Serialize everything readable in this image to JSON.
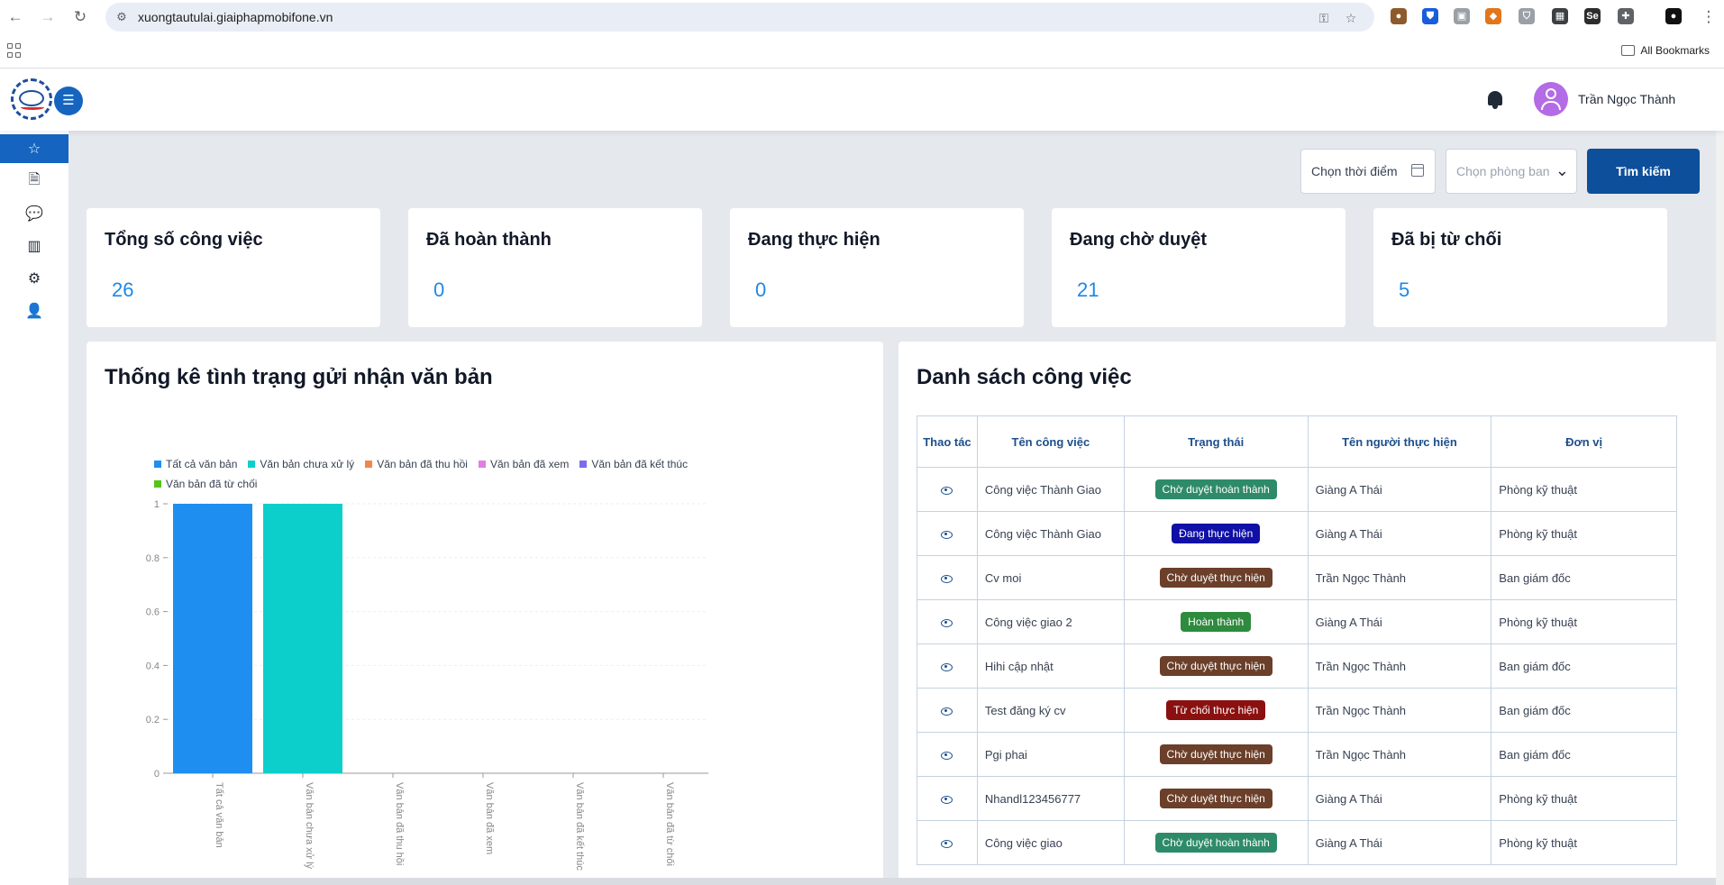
{
  "browser": {
    "url": "xuongtautulai.giaiphapmobifone.vn",
    "bookmarks_label": "All Bookmarks",
    "extensions": [
      {
        "name": "cookie-extension-icon",
        "color": "#8d5a2b",
        "glyph": "●"
      },
      {
        "name": "bitwarden-extension-icon",
        "color": "#175ddc",
        "glyph": "⛊"
      },
      {
        "name": "image-extension-icon",
        "color": "#9aa0a6",
        "glyph": "▣"
      },
      {
        "name": "metamask-extension-icon",
        "color": "#e2761b",
        "glyph": "◆"
      },
      {
        "name": "shield-extension-icon",
        "color": "#9aa0a6",
        "glyph": "⛉"
      },
      {
        "name": "qr-extension-icon",
        "color": "#3c4043",
        "glyph": "▦"
      },
      {
        "name": "selenium-extension-icon",
        "color": "#2d2d2d",
        "glyph": "Se"
      },
      {
        "name": "puzzle-extension-icon",
        "color": "#5f6368",
        "glyph": "✚"
      },
      {
        "name": "profile-extension-icon",
        "color": "#111111",
        "glyph": "●"
      }
    ]
  },
  "header": {
    "user_name": "Trần Ngọc Thành"
  },
  "sidebar": {
    "items": [
      {
        "name": "sidebar-item-favorites",
        "icon": "star-icon",
        "glyph": "☆",
        "active": true
      },
      {
        "name": "sidebar-item-documents",
        "icon": "document-icon",
        "glyph": "🗎",
        "active": false
      },
      {
        "name": "sidebar-item-messages",
        "icon": "chat-icon",
        "glyph": "💬",
        "active": false
      },
      {
        "name": "sidebar-item-board",
        "icon": "kanban-icon",
        "glyph": "▥",
        "active": false
      },
      {
        "name": "sidebar-item-settings",
        "icon": "gear-icon",
        "glyph": "⚙",
        "active": false
      },
      {
        "name": "sidebar-item-users",
        "icon": "user-icon",
        "glyph": "👤",
        "active": false
      }
    ]
  },
  "filters": {
    "time_label": "Chọn thời điểm",
    "dept_placeholder": "Chọn phòng ban",
    "search_label": "Tìm kiếm"
  },
  "stats": [
    {
      "title": "Tổng số công việc",
      "value": "26"
    },
    {
      "title": "Đã hoàn thành",
      "value": "0"
    },
    {
      "title": "Đang thực hiện",
      "value": "0"
    },
    {
      "title": "Đang chờ duyệt",
      "value": "21"
    },
    {
      "title": "Đã bị từ chối",
      "value": "5"
    }
  ],
  "chart_panel": {
    "title": "Thống kê tình trạng gửi nhận văn bản"
  },
  "chart_data": {
    "type": "bar",
    "categories": [
      "Tất cả văn bản",
      "Văn bản chưa xử lý",
      "Văn bản đã thu hồi",
      "Văn bản đã xem",
      "Văn bản đã kết thúc",
      "Văn bản đã từ chối"
    ],
    "values": [
      1,
      1,
      0,
      0,
      0,
      0
    ],
    "colors": [
      "#1f8ef1",
      "#0ccfcc",
      "#f2874d",
      "#e07ee6",
      "#7a6cf0",
      "#52c41a"
    ],
    "ylim": [
      0,
      1
    ],
    "yticks": [
      "0",
      "0.2",
      "0.4",
      "0.6",
      "0.8",
      "1"
    ],
    "legend_placement": "top-left",
    "grid": true
  },
  "task_panel": {
    "title": "Danh sách công việc",
    "columns": [
      "Thao tác",
      "Tên công việc",
      "Trạng thái",
      "Tên người thực hiện",
      "Đơn vị"
    ],
    "rows": [
      {
        "name": "Công việc Thành Giao",
        "status": "Chờ duyệt hoàn thành",
        "status_color": "#2e8b6a",
        "assignee": "Giàng A Thái",
        "unit": "Phòng kỹ thuật"
      },
      {
        "name": "Công việc Thành Giao",
        "status": "Đang thực hiện",
        "status_color": "#1010a6",
        "assignee": "Giàng A Thái",
        "unit": "Phòng kỹ thuật"
      },
      {
        "name": "Cv moi",
        "status": "Chờ duyệt thực hiện",
        "status_color": "#6b3f2a",
        "assignee": "Trần Ngọc Thành",
        "unit": "Ban giám đốc"
      },
      {
        "name": "Công việc giao 2",
        "status": "Hoàn thành",
        "status_color": "#2e8b3e",
        "assignee": "Giàng A Thái",
        "unit": "Phòng kỹ thuật"
      },
      {
        "name": "Hihi cập nhật",
        "status": "Chờ duyệt thực hiện",
        "status_color": "#6b3f2a",
        "assignee": "Trần Ngọc Thành",
        "unit": "Ban giám đốc"
      },
      {
        "name": "Test đăng ký cv",
        "status": "Từ chối thực hiện",
        "status_color": "#8b1010",
        "assignee": "Trần Ngọc Thành",
        "unit": "Ban giám đốc"
      },
      {
        "name": "Pgi phai",
        "status": "Chờ duyệt thực hiện",
        "status_color": "#6b3f2a",
        "assignee": "Trần Ngọc Thành",
        "unit": "Ban giám đốc"
      },
      {
        "name": "Nhandl123456777",
        "status": "Chờ duyệt thực hiện",
        "status_color": "#6b3f2a",
        "assignee": "Giàng A Thái",
        "unit": "Phòng kỹ thuật"
      },
      {
        "name": "Công việc giao",
        "status": "Chờ duyệt hoàn thành",
        "status_color": "#2e8b6a",
        "assignee": "Giàng A Thái",
        "unit": "Phòng kỹ thuật"
      }
    ]
  }
}
